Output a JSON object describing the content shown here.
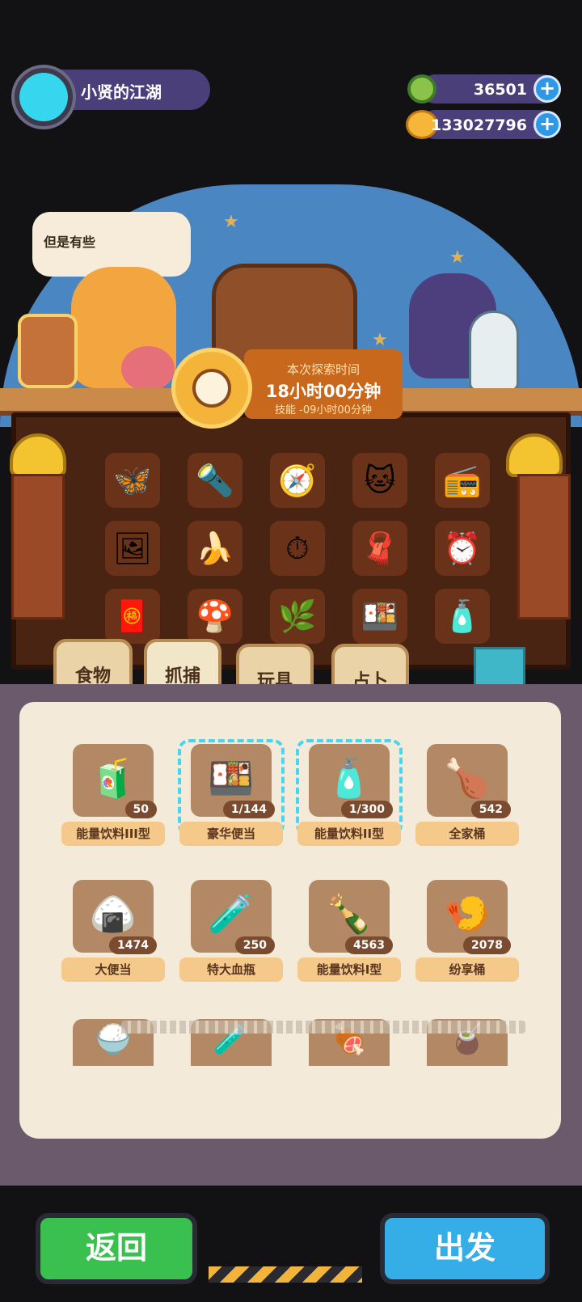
{
  "player": {
    "name": "小贤的江湖"
  },
  "currencies": [
    {
      "icon": "gem-icon",
      "value": "36501"
    },
    {
      "icon": "coin-icon",
      "value": "133027796"
    }
  ],
  "speech_bubble": "但是有些",
  "exploration": {
    "label": "本次探索时间",
    "time": "18小时00分钟",
    "skill": "技能 -09小时00分钟"
  },
  "equipped_slots": [
    {
      "icon": "🦋"
    },
    {
      "icon": "🔦"
    },
    {
      "icon": "🧭"
    },
    {
      "icon": "🐱"
    },
    {
      "icon": "📻"
    },
    {
      "icon": "🖼"
    },
    {
      "icon": "🍌"
    },
    {
      "icon": "⏱"
    },
    {
      "icon": "🧣"
    },
    {
      "icon": "⏰"
    },
    {
      "icon": "🧧"
    },
    {
      "icon": "🍄"
    },
    {
      "icon": "🌿"
    },
    {
      "icon": "🍱"
    },
    {
      "icon": "🧴"
    }
  ],
  "tabs": [
    {
      "label": "食物"
    },
    {
      "label": "抓捕"
    },
    {
      "label": "玩具"
    },
    {
      "label": "占卜"
    }
  ],
  "items": [
    {
      "name": "能量饮料III型",
      "count": "50",
      "icon": "🧃",
      "selected": false
    },
    {
      "name": "豪华便当",
      "count": "1/144",
      "icon": "🍱",
      "selected": true
    },
    {
      "name": "能量饮料II型",
      "count": "1/300",
      "icon": "🧴",
      "selected": true
    },
    {
      "name": "全家桶",
      "count": "542",
      "icon": "🍗",
      "selected": false
    },
    {
      "name": "大便当",
      "count": "1474",
      "icon": "🍙",
      "selected": false
    },
    {
      "name": "特大血瓶",
      "count": "250",
      "icon": "🧪",
      "selected": false
    },
    {
      "name": "能量饮料I型",
      "count": "4563",
      "icon": "🍾",
      "selected": false
    },
    {
      "name": "纷享桶",
      "count": "2078",
      "icon": "🍤",
      "selected": false
    }
  ],
  "partial_items": [
    {
      "icon": "🍚"
    },
    {
      "icon": "🧪"
    },
    {
      "icon": "🍖"
    },
    {
      "icon": "🧉"
    }
  ],
  "buttons": {
    "back": "返回",
    "go": "出发"
  },
  "colors": {
    "accent_green": "#3ac04e",
    "accent_blue": "#35aee8",
    "selection": "#45d6f0"
  }
}
